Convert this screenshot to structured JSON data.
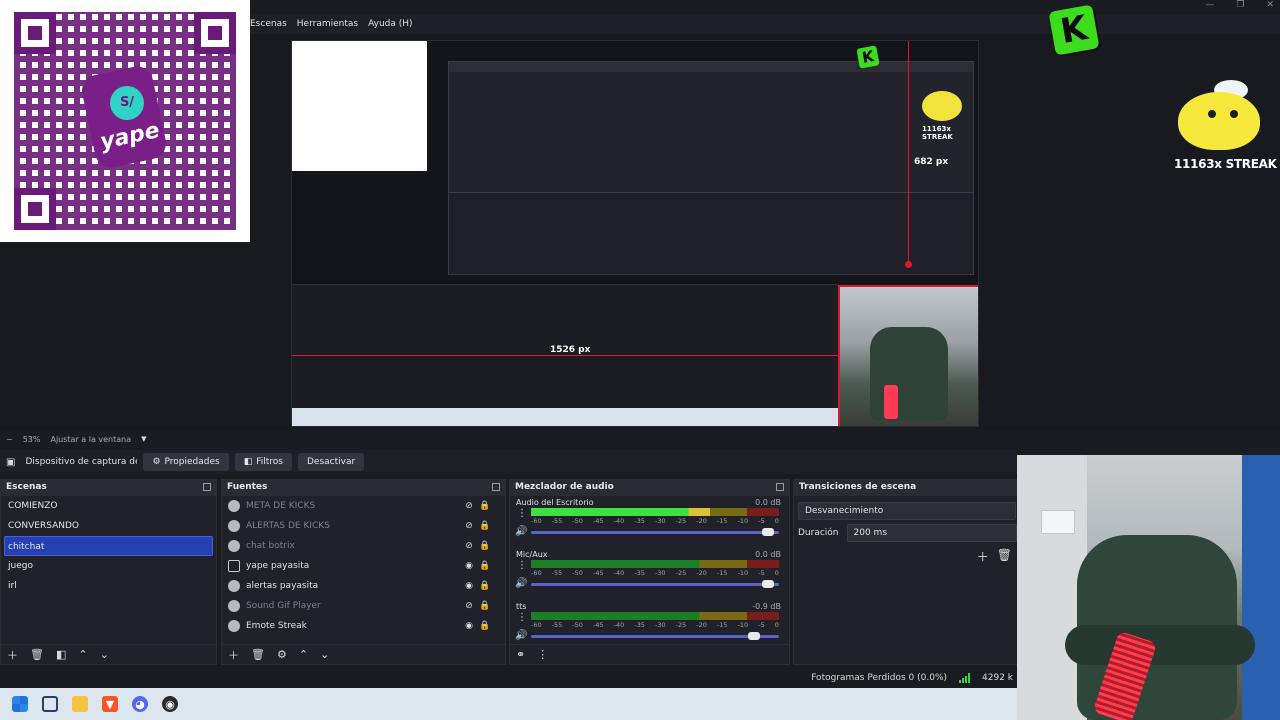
{
  "menu": [
    "Escenas",
    "Herramientas",
    "Ayuda (H)"
  ],
  "window_controls": [
    "—",
    "❐",
    "✕"
  ],
  "overlays": {
    "qr_brand": "yape",
    "qr_coin": "S/",
    "kick_letter": "K",
    "streak_text": "11163x STREAK"
  },
  "preview": {
    "guide_v_label": "682 px",
    "guide_h_label": "1526 px"
  },
  "zoombar": {
    "minus": "−",
    "zoom": "53%",
    "fit": "Ajustar a la ventana"
  },
  "source_toolbar": {
    "source_name": "Dispositivo de captura de v",
    "properties": "Propiedades",
    "filters": "Filtros",
    "deactivate": "Desactivar"
  },
  "scenes": {
    "title": "Escenas",
    "items": [
      {
        "label": "COMIENZO",
        "active": false
      },
      {
        "label": "CONVERSANDO",
        "active": false
      },
      {
        "label": "chitchat",
        "active": true
      },
      {
        "label": "juego",
        "active": false
      },
      {
        "label": "irl",
        "active": false
      }
    ]
  },
  "sources": {
    "title": "Fuentes",
    "items": [
      {
        "label": "META DE KICKS",
        "visible": false
      },
      {
        "label": "ALERTAS DE KICKS",
        "visible": false
      },
      {
        "label": "chat botrix",
        "visible": false
      },
      {
        "label": "yape payasita",
        "visible": true
      },
      {
        "label": "alertas payasita",
        "visible": true
      },
      {
        "label": "Sound Gif Player",
        "visible": false
      },
      {
        "label": "Emote Streak",
        "visible": true
      }
    ]
  },
  "mixer": {
    "title": "Mezclador de audio",
    "scale": [
      "-60",
      "-55",
      "-50",
      "-45",
      "-40",
      "-35",
      "-30",
      "-25",
      "-20",
      "-15",
      "-10",
      "-5",
      "0"
    ],
    "channels": [
      {
        "name": "Audio del Escritorio",
        "db": "0.0 dB",
        "level": 0.72,
        "fader": 0.98
      },
      {
        "name": "Mic/Aux",
        "db": "0.0 dB",
        "level": 0.0,
        "fader": 0.98
      },
      {
        "name": "tts",
        "db": "-0.9 dB",
        "level": 0.0,
        "fader": 0.92
      }
    ]
  },
  "transitions": {
    "title": "Transiciones de escena",
    "selected": "Desvanecimiento",
    "duration_label": "Duración",
    "duration_value": "200 ms"
  },
  "status": {
    "dropped_frames": "Fotogramas Perdidos 0 (0.0%)",
    "bitrate": "4292 k"
  },
  "taskbar": {
    "icons": [
      "windows-start",
      "task-view",
      "file-explorer",
      "brave",
      "discord",
      "obs"
    ]
  },
  "colors": {
    "accent_selection": "#2540b3",
    "guide_red": "#e0182e",
    "kick_green": "#3ddc1e",
    "yape_purple": "#6a1a78"
  }
}
